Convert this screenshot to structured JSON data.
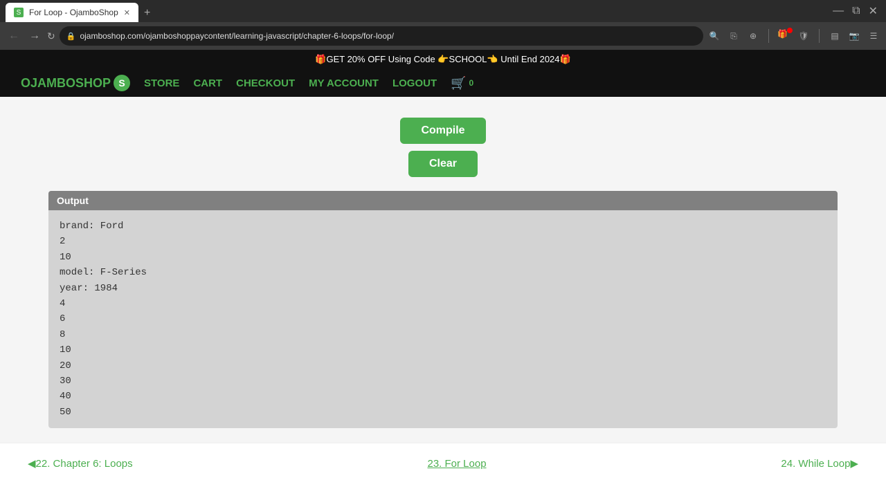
{
  "browser": {
    "tab_title": "For Loop - OjamboShop",
    "url": "ojamboshop.com/ojamboshoppaycontent/learning-javascript/chapter-6-loops/for-loop/",
    "favicon": "S"
  },
  "promo": {
    "text": "🎁GET 20% OFF Using Code 👉SCHOOL👈 Until End 2024🎁"
  },
  "nav": {
    "logo_text": "OJAMBOSHOP",
    "logo_s": "S",
    "store": "STORE",
    "cart": "CART",
    "checkout": "CHECKOUT",
    "my_account": "MY ACCOUNT",
    "logout": "LOGOUT",
    "cart_count": "0"
  },
  "buttons": {
    "compile": "Compile",
    "clear": "Clear"
  },
  "output": {
    "header": "Output",
    "lines": [
      "brand: Ford",
      "2",
      "10",
      "model: F-Series",
      "year: 1984",
      "4",
      "6",
      "8",
      "10",
      "20",
      "30",
      "40",
      "50"
    ]
  },
  "pagination": {
    "prev_label": "◀22. Chapter 6: Loops",
    "current_label": "23. For Loop",
    "next_label": "24. While Loop▶"
  }
}
